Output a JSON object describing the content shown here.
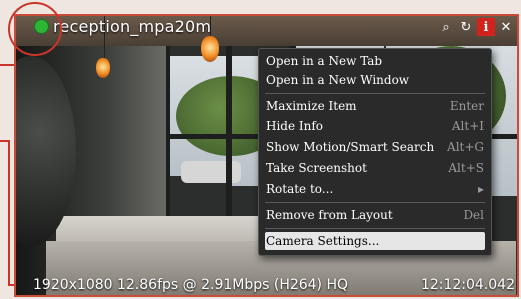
{
  "camera": {
    "name": "reception_mpa20m",
    "status_color": "#2db535",
    "stream_info": "1920x1080 12.86fps @ 2.91Mbps (H264) HQ",
    "timestamp": "12:12:04.042"
  },
  "toolbar_icons": {
    "search": "⌕",
    "rotate": "↻",
    "info": "i",
    "close": "✕"
  },
  "context_menu": {
    "items": [
      {
        "label": "Open in a New Tab",
        "shortcut": ""
      },
      {
        "label": "Open in a New Window",
        "shortcut": ""
      },
      {
        "label": "Maximize Item",
        "shortcut": "Enter"
      },
      {
        "label": "Hide Info",
        "shortcut": "Alt+I"
      },
      {
        "label": "Show Motion/Smart Search",
        "shortcut": "Alt+G"
      },
      {
        "label": "Take Screenshot",
        "shortcut": "Alt+S"
      },
      {
        "label": "Rotate to...",
        "shortcut": "▸"
      },
      {
        "label": "Remove from Layout",
        "shortcut": "Del"
      },
      {
        "label": "Camera Settings...",
        "shortcut": ""
      }
    ]
  },
  "colors": {
    "accent_border": "#c94b3a",
    "info_button": "#d3211b"
  }
}
